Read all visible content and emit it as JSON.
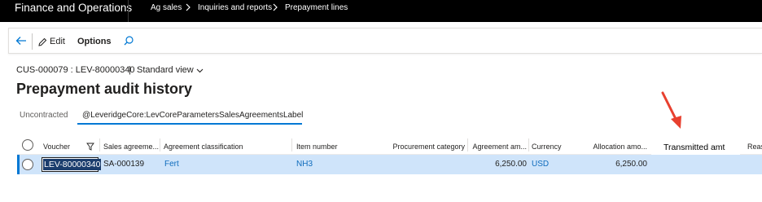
{
  "topbar": {
    "app_name": "Finance and Operations",
    "breadcrumbs": [
      "Ag sales",
      "Inquiries and reports",
      "Prepayment lines"
    ]
  },
  "actionpane": {
    "edit_label": "Edit",
    "options_label": "Options"
  },
  "header": {
    "record_id": "CUS-000079 : LEV-80000340",
    "divider": "|",
    "view_name": "Standard view",
    "title": "Prepayment audit history"
  },
  "tabs": [
    {
      "label": "Uncontracted",
      "active": false
    },
    {
      "label": "@LeveridgeCore:LevCoreParametersSalesAgreementsLabel",
      "active": true
    }
  ],
  "grid": {
    "columns": [
      "Voucher",
      "Sales agreeme...",
      "Agreement classification",
      "Item number",
      "Procurement category",
      "Agreement am...",
      "Currency",
      "Allocation amo...",
      "Transmitted amt",
      "Reas"
    ],
    "rows": [
      {
        "voucher": "LEV-80000340",
        "sales_agreement": "SA-000139",
        "agreement_classification": "Fert",
        "item_number": "NH3",
        "procurement_category": "",
        "agreement_amount": "6,250.00",
        "currency": "USD",
        "allocation_amount": "6,250.00",
        "transmitted_amt": "",
        "reason": ""
      }
    ]
  },
  "colors": {
    "topbar_bg": "#000000",
    "accent": "#0078d4",
    "link": "#0f6cbd",
    "selected_row": "#cfe4fa",
    "annotation_arrow": "#e8402f"
  },
  "icons": [
    "back-arrow-icon",
    "pencil-icon",
    "search-icon",
    "chevron-down-icon",
    "filter-icon",
    "chevron-right-icon"
  ]
}
